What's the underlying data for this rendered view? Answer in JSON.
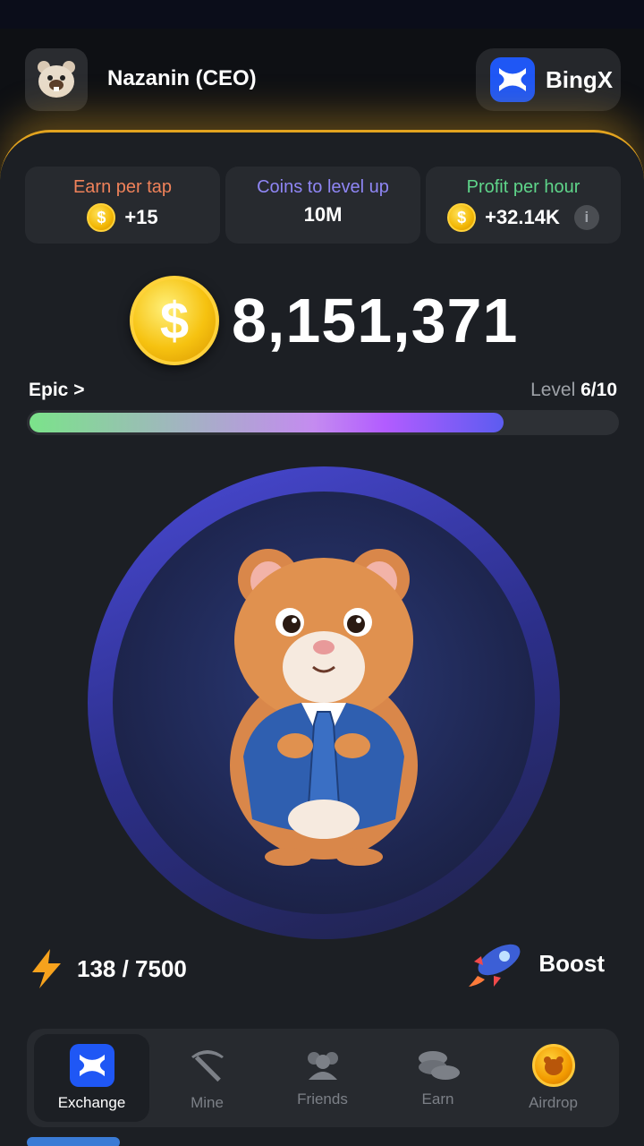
{
  "header": {
    "username": "Nazanin (CEO)",
    "exchange_label": "BingX",
    "avatar_icon": "hamster-avatar-icon"
  },
  "stats": [
    {
      "title": "Earn per tap",
      "value": "+15",
      "title_color": "#f0825a",
      "icon": "coin-icon"
    },
    {
      "title": "Coins to level up",
      "value": "10M",
      "title_color": "#8f86f5"
    },
    {
      "title": "Profit per hour",
      "value": "+32.14K",
      "title_color": "#5fd58a",
      "icon": "coin-icon"
    }
  ],
  "balance": {
    "value": "8,151,371",
    "coin_symbol": "$"
  },
  "progress": {
    "rank": "Epic",
    "rank_chevron": ">",
    "level_prefix": "Level",
    "level_value": "6/10",
    "fill_fraction": 0.81
  },
  "energy": {
    "value": "138 / 7500"
  },
  "boost": {
    "label": "Boost"
  },
  "nav": [
    {
      "label": "Exchange",
      "icon": "exchange-icon",
      "active": true
    },
    {
      "label": "Mine",
      "icon": "pickaxe-icon",
      "active": false
    },
    {
      "label": "Friends",
      "icon": "friends-icon",
      "active": false
    },
    {
      "label": "Earn",
      "icon": "coins-stack-icon",
      "active": false
    },
    {
      "label": "Airdrop",
      "icon": "airdrop-coin-icon",
      "active": false
    }
  ],
  "colors": {
    "accent_gold": "#e2a31f",
    "bingx_blue": "#1f57f5",
    "panel_bg": "#1c1f24"
  }
}
